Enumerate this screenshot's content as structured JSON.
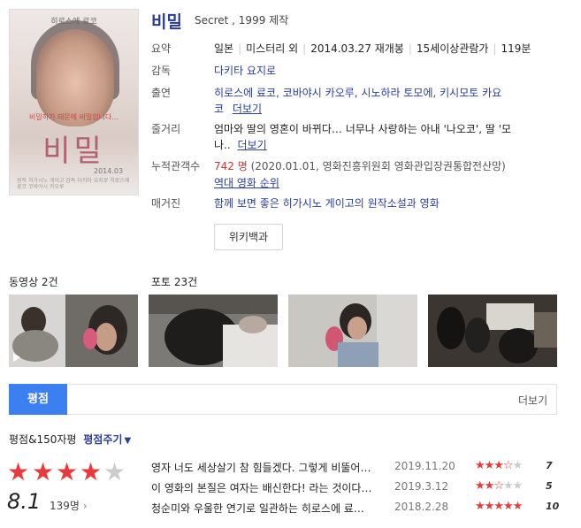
{
  "poster": {
    "top_label": "히로스에 료코",
    "tagline": "비밀하기 때문에 비밀입니다...",
    "title_art": "비밀",
    "date": "2014.03",
    "credits": "원작 히가시노 게이고 감독 다키타 요지로 히로스에 료코 코바야시 카오루"
  },
  "movie": {
    "title": "비밀",
    "subtitle": "Secret , 1999 제작"
  },
  "info": {
    "summary_label": "요약",
    "summary": [
      "일본",
      "미스터리 외",
      "2014.03.27 재개봉",
      "15세이상관람가",
      "119분"
    ],
    "director_label": "감독",
    "director": "다키타 요지로",
    "cast_label": "출연",
    "cast_line1": "히로스에 료코, 코바야시 카오루, 시노하라 토모에, 키시모토 카요",
    "cast_line2": "코",
    "cast_more": "더보기",
    "plot_label": "줄거리",
    "plot_line1": "엄마와 딸의 영혼이 바뀌다… 너무나 사랑하는 아내 '나오코', 딸 '모",
    "plot_line2": "나..",
    "plot_more": "더보기",
    "audience_label": "누적관객수",
    "audience_count": "742 명",
    "audience_source": "(2020.01.01, 영화진흥위원회 영화관입장권통합전산망)",
    "audience_rank": "역대 영화 순위",
    "hook_label": "매거진",
    "hook": "함께 보면 좋은 히가시노 게이고의 원작소설과 영화",
    "wiki_button": "위키백과"
  },
  "media": {
    "video_label": "동영상 2건",
    "photo_label": "포토 23건"
  },
  "tabs": {
    "active": "평점",
    "more": "더보기"
  },
  "ratings": {
    "header": "평점&150자평",
    "give_rating": "평점주기",
    "average": "8.1",
    "stars_filled": 4,
    "count": "139명",
    "reviews": [
      {
        "text": "영자 너도 세상살기 참 힘들겠다. 그렇게 비뚤어…",
        "date": "2019.11.20",
        "score": "7",
        "rating": 3.5
      },
      {
        "text": "이 영화의 본질은 여자는 배신한다! 라는 것이다…",
        "date": "2019.3.12",
        "score": "5",
        "rating": 2.5
      },
      {
        "text": "청순미와 우울한 연기로 일관하는 히로스에 료…",
        "date": "2018.2.28",
        "score": "10",
        "rating": 5
      }
    ]
  },
  "colors": {
    "accent": "#3b7ff0",
    "title": "#2a3a9a",
    "star": "#e83a3a",
    "audience": "#c23838"
  }
}
